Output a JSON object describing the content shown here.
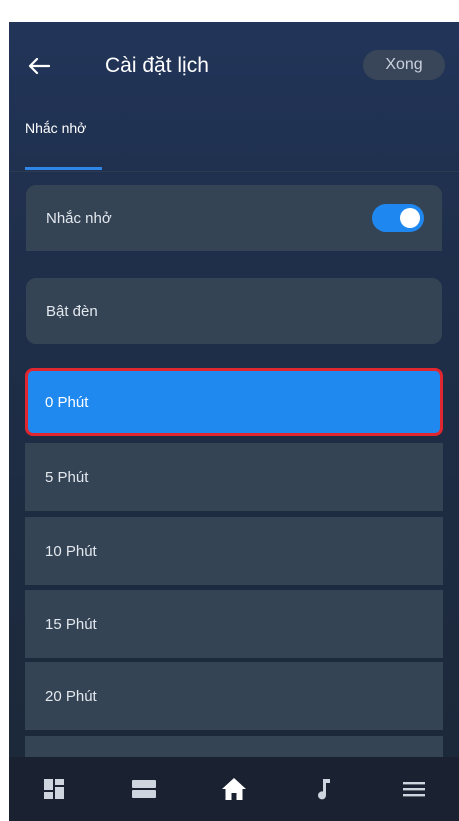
{
  "header": {
    "title": "Cài đặt lịch",
    "done_label": "Xong"
  },
  "tabs": [
    {
      "label": "Nhắc nhở",
      "active": true
    }
  ],
  "reminder": {
    "label": "Nhắc nhở",
    "enabled": true
  },
  "light": {
    "label": "Bật đèn"
  },
  "options": [
    {
      "label": "0 Phút",
      "selected": true
    },
    {
      "label": "5 Phút",
      "selected": false
    },
    {
      "label": "10 Phút",
      "selected": false
    },
    {
      "label": "15 Phút",
      "selected": false
    },
    {
      "label": "20 Phút",
      "selected": false
    },
    {
      "label": "",
      "selected": false
    }
  ],
  "navbar": {
    "items": [
      {
        "icon": "dashboard-icon"
      },
      {
        "icon": "list-icon"
      },
      {
        "icon": "home-icon",
        "active": true
      },
      {
        "icon": "music-icon"
      },
      {
        "icon": "menu-icon"
      }
    ]
  },
  "colors": {
    "accent": "#1f89f0",
    "selected_border": "#e0262f",
    "card": "#354454",
    "background": "#1f2f4b"
  }
}
